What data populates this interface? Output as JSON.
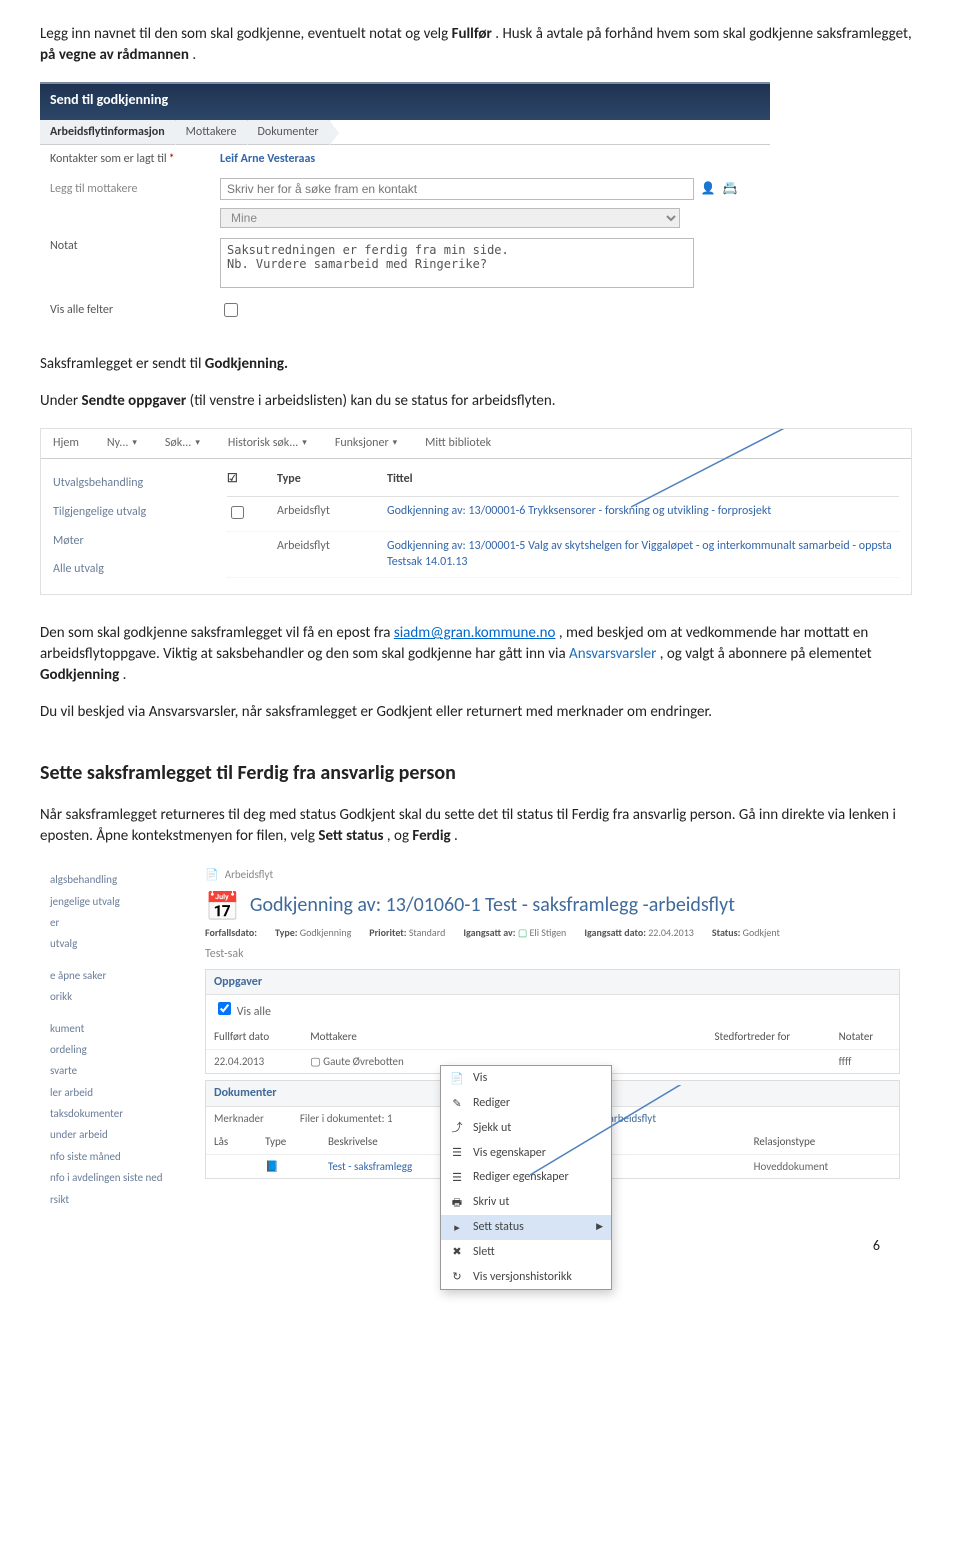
{
  "para1": {
    "pre": "Legg inn navnet til den som skal godkjenne, eventuelt notat og velg ",
    "bold1": "Fullfør",
    "mid": ". Husk å avtale på forhånd hvem som skal godkjenne saksframlegget, ",
    "bold2": "på vegne av rådmannen",
    "tail": "."
  },
  "shot1": {
    "title": "Send til godkjenning",
    "tabs": [
      "Arbeidsflytinformasjon",
      "Mottakere",
      "Dokumenter"
    ],
    "kontakter_lbl": "Kontakter som er lagt til",
    "kontakter_val": "Leif Arne Vesteraas",
    "leggtil_lbl": "Legg til mottakere",
    "legg_placeholder": "Skriv her for å søke fram en kontakt",
    "mine": "Mine",
    "notat_lbl": "Notat",
    "notat_text": "Saksutredningen er ferdig fra min side.\nNb. Vurdere samarbeid med Ringerike?",
    "vis_lbl": "Vis alle felter"
  },
  "para2a": "Saksframlegget er sendt til ",
  "para2b": "Godkjenning.",
  "para3": {
    "pre": "Under ",
    "bold": "Sendte oppgaver",
    "tail": " (til venstre i arbeidslisten) kan du se status for arbeidsflyten."
  },
  "shot2": {
    "menu": [
      "Hjem",
      "Ny...",
      "Søk...",
      "Historisk søk...",
      "Funksjoner",
      "Mitt bibliotek"
    ],
    "side": [
      "Utvalgsbehandling",
      "Tilgjengelige utvalg",
      "Møter",
      "Alle utvalg"
    ],
    "col_type": "Type",
    "col_tittel": "Tittel",
    "af": "Arbeidsflyt",
    "row1": "Godkjenning av: 13/00001-6 Trykksensorer - forskning og utvikling - forprosjekt",
    "row2a": "Godkjenning av: 13/00001-5 Valg av skytshelgen for Viggaløpet - og interkommunalt samarbeid - oppsta",
    "row2b": "Testsak 14.01.13"
  },
  "para4": {
    "pre": "Den som skal godkjenne saksframlegget vil få en epost fra ",
    "mail": "siadm@gran.kommune.no",
    "mid": " , med beskjed om at vedkommende har mottatt en arbeidsflytoppgave. Viktig at saksbehandler og den som skal godkjenne har gått inn via ",
    "link": "Ansvarsvarsler",
    "mid2": ", og valgt å abonnere på elementet ",
    "bold": "Godkjenning",
    "tail": "."
  },
  "para5": "Du vil beskjed via Ansvarsvarsler, når saksframlegget er Godkjent eller returnert med merknader om endringer.",
  "h2": "Sette saksframlegget til Ferdig fra ansvarlig person",
  "para6": {
    "a": "Når saksframlegget returneres til deg med status Godkjent skal du sette det til status til Ferdig fra ansvarlig person. Gå inn direkte via lenken i eposten.  Åpne kontekstmenyen for filen, velg ",
    "b1": "Sett status",
    "c": ", og ",
    "b2": "Ferdig",
    "d": "."
  },
  "shot3": {
    "side": [
      "algsbehandling",
      "jengelige utvalg",
      "er",
      "utvalg",
      "",
      "e åpne saker",
      "orikk",
      "",
      "kument",
      "ordeling",
      "svarte",
      "ler arbeid",
      "taksdokumenter",
      "under arbeid",
      "nfo siste måned",
      "nfo i avdelingen siste ned",
      "rsikt"
    ],
    "bread": "Arbeidsflyt",
    "doctitle": "Godkjenning av: 13/01060-1 Test - saksframlegg -arbeidsflyt",
    "meta_labels": {
      "forfall": "Forfallsdato:",
      "type": "Type:",
      "prio": "Prioritet:",
      "igangAv": "Igangsatt av:",
      "igangDate": "Igangsatt dato:",
      "status": "Status:"
    },
    "meta_vals": {
      "type": "Godkjenning",
      "prio": "Standard",
      "igangAv": "Eli Stigen",
      "igangDate": "22.04.2013",
      "status": "Godkjent"
    },
    "testsak": "Test-sak",
    "box_opp": "Oppgaver",
    "visalle": "Vis alle",
    "th_full": "Fullført dato",
    "th_mott": "Mottakere",
    "th_sted": "Stedfortreder for",
    "th_not": "Notater",
    "td_date": "22.04.2013",
    "td_mott": "Gaute Øvrebotten",
    "td_not": "ffff",
    "box_dok": "Dokumenter",
    "dok_lbl": "Merknader",
    "dok_filer": "Filer i dokumentet:",
    "dok_filer_n": "1",
    "th_ars": "arbeidsflyt",
    "th_las": "Lås",
    "th_typ": "Type",
    "th_besk": "Beskrivelse",
    "th_rel": "Relasjonstype",
    "td_besk": "Test - saksframlegg",
    "td_rel": "Hoveddokument"
  },
  "ctxmenu": {
    "items": [
      "Vis",
      "Rediger",
      "Sjekk ut",
      "Vis egenskaper",
      "Rediger egenskaper",
      "Skriv ut",
      "Sett status",
      "Slett",
      "Vis versjonshistorikk"
    ],
    "sel_index": 6
  },
  "pagenum": "6"
}
